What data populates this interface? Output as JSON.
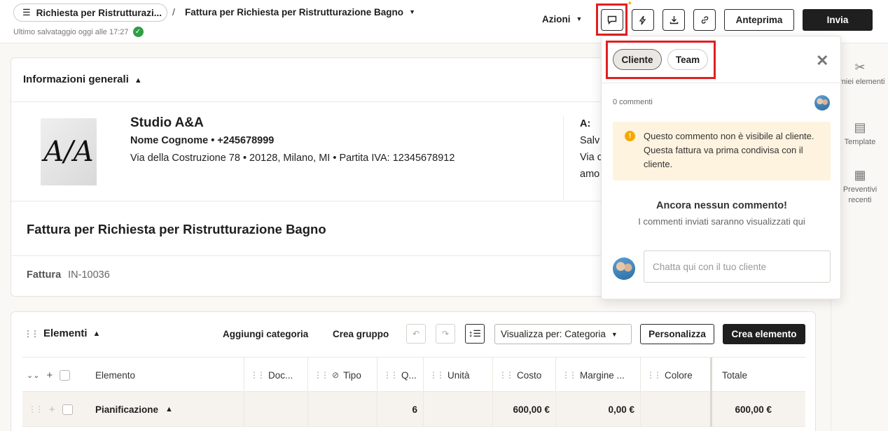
{
  "header": {
    "breadcrumb_label": "Richiesta per Ristrutturazi...",
    "breadcrumb_sep": "/",
    "doc_title": "Fattura per Richiesta per Ristrutturazione Bagno",
    "save_status": "Ultimo salvataggio oggi alle 17:27",
    "actions_label": "Azioni",
    "preview_label": "Anteprima",
    "send_label": "Invia"
  },
  "general": {
    "section_title": "Informazioni generali",
    "company_name": "Studio A&A",
    "contact_line": "Nome Cognome  •  +245678999",
    "address_line": "Via della Costruzione 78   •   20128, Milano, MI   •   Partita IVA: 12345678912",
    "to_label": "A:",
    "to_lines": [
      "Salv",
      "Via c",
      "amo"
    ],
    "invoice_title": "Fattura per Richiesta per Ristrutturazione Bagno",
    "invoice_type_label": "Fattura",
    "invoice_number": "IN-10036"
  },
  "elements": {
    "section_title": "Elementi",
    "add_category": "Aggiungi categoria",
    "create_group": "Crea gruppo",
    "view_by": "Visualizza per: Categoria",
    "customize": "Personalizza",
    "create_element": "Crea elemento",
    "columns": [
      "Elemento",
      "Doc...",
      "Tipo",
      "Q...",
      "Unità",
      "Costo",
      "Margine ...",
      "Colore",
      "Totale"
    ],
    "rows": [
      {
        "name": "Pianificazione",
        "qty": "6",
        "cost": "600,00 €",
        "margin": "0,00 €",
        "total": "600,00 €"
      }
    ]
  },
  "comments": {
    "tabs": [
      "Cliente",
      "Team"
    ],
    "active_tab": "Cliente",
    "count_label": "0 commenti",
    "warning": "Questo commento non è visibile al cliente. Questa fattura va prima condivisa con il cliente.",
    "empty_title": "Ancora nessun commento!",
    "empty_subtitle": "I commenti inviati saranno visualizzati qui",
    "input_placeholder": "Chatta qui con il tuo cliente"
  },
  "rail": {
    "items": [
      {
        "label": "I miei elementi",
        "icon": "tools-icon"
      },
      {
        "label": "Template",
        "icon": "template-icon"
      },
      {
        "label": "Preventivi recenti",
        "icon": "calculator-icon"
      }
    ]
  },
  "colors": {
    "accent_dark": "#1f1f1f",
    "highlight_red": "#e02020",
    "warning_bg": "#fdf3df",
    "success_green": "#2f9e44"
  }
}
